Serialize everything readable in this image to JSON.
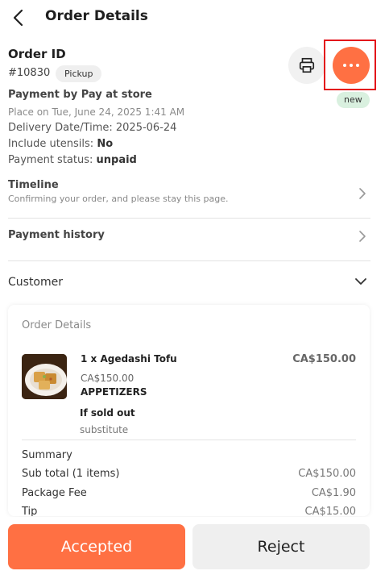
{
  "header": {
    "title": "Order Details",
    "back_icon": "chevron-left-icon"
  },
  "order": {
    "id_label": "Order ID",
    "number": "#10830",
    "type_badge": "Pickup",
    "status_badge": "new",
    "payment_by": "Payment by Pay at store",
    "placed_on": "Place on Tue, June 24, 2025 1:41 AM",
    "delivery_label": "Delivery Date/Time:",
    "delivery_value": "2025-06-24",
    "utensils_label": "Include utensils:",
    "utensils_value": "No",
    "payment_status_label": "Payment status:",
    "payment_status_value": "unpaid"
  },
  "actions": {
    "print_icon": "printer-icon",
    "more_icon": "more-dots-icon",
    "more_color": "#ff7043",
    "highlight_color": "#e3141b"
  },
  "timeline": {
    "title": "Timeline",
    "subtitle": "Confirming your order, and please stay this page."
  },
  "payment_history": {
    "title": "Payment history"
  },
  "customer": {
    "label": "Customer"
  },
  "order_details": {
    "heading": "Order Details",
    "items": [
      {
        "name": "1 x Agedashi Tofu",
        "total": "CA$150.00",
        "price": "CA$150.00",
        "category": "APPETIZERS",
        "if_sold_out_label": "If sold out",
        "if_sold_out_value": "substitute"
      }
    ],
    "summary_label": "Summary",
    "summary": [
      {
        "label": "Sub total (1 items)",
        "value": "CA$150.00"
      },
      {
        "label": "Package Fee",
        "value": "CA$1.90"
      },
      {
        "label": "Tip",
        "value": "CA$15.00"
      }
    ]
  },
  "buttons": {
    "accept": "Accepted",
    "reject": "Reject",
    "accent_color": "#ff7043"
  }
}
